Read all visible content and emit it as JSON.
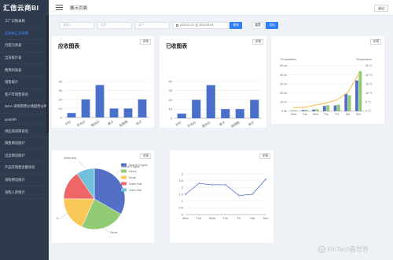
{
  "brand": "汇信云商BI",
  "sidebar": {
    "items": [
      {
        "label": "工厂记账表格",
        "active": false
      },
      {
        "label": "应收帐汇总周期",
        "active": true
      },
      {
        "label": "月度交易表",
        "active": false
      },
      {
        "label": "出货统计表",
        "active": false
      },
      {
        "label": "费用利润表",
        "active": false
      },
      {
        "label": "销售统计",
        "active": false
      },
      {
        "label": "客户年销售排名",
        "active": false
      },
      {
        "label": "WXA-采购销售价格趋势分析",
        "active": false
      },
      {
        "label": "quoteBI",
        "active": false
      },
      {
        "label": "供应商采购排名",
        "active": false
      },
      {
        "label": "销售情况统计",
        "active": false
      },
      {
        "label": "出运情况统计",
        "active": false
      },
      {
        "label": "产品年销售金额排名",
        "active": false
      },
      {
        "label": "采购情况统计",
        "active": false
      },
      {
        "label": "采购入库统计",
        "active": false
      }
    ]
  },
  "header": {
    "title": "展示页面",
    "right_button": "退出"
  },
  "filters": {
    "input1_placeholder": "请输入",
    "input2_placeholder": "品项",
    "input3_placeholder": "客户",
    "date_range": "2024-01-01 至 2024-09-04",
    "search_label": "查询",
    "reset_label": "重置",
    "export_label": "导出"
  },
  "detail_label": "详情",
  "colors": {
    "sidebar_bg": "#2f3a4d",
    "accent": "#2d7ff9",
    "bar_blue": "#4a6fc9",
    "pie_blue": "#5470c6",
    "pie_green": "#91cc75",
    "pie_yellow": "#fac858",
    "pie_red": "#ee6666",
    "pie_cyan": "#73c0de",
    "line_orange": "#f2b233"
  },
  "watermark": "FinTech看世界",
  "chart_data": [
    {
      "type": "bar",
      "title": "应收图表",
      "categories": [
        "衬衫",
        "羊毛衫",
        "雪纺衫",
        "裤子",
        "高跟鞋",
        "袜子"
      ],
      "values": [
        5,
        20,
        36,
        10,
        10,
        20
      ],
      "ylim": [
        0,
        40
      ],
      "yticks": [
        0,
        10,
        20,
        30,
        40
      ],
      "color": "#4a6fc9"
    },
    {
      "type": "bar",
      "title": "已收图表",
      "categories": [
        "衬衫",
        "羊毛衫",
        "雪纺衫",
        "裤子",
        "高跟鞋",
        "袜子"
      ],
      "values": [
        5,
        20,
        36,
        10,
        10,
        20
      ],
      "ylim": [
        0,
        40
      ],
      "yticks": [
        0,
        10,
        20,
        30,
        40
      ],
      "color": "#4a6fc9"
    },
    {
      "type": "bar",
      "title": "",
      "categories": [
        "Mon",
        "Tue",
        "Wed",
        "Thu",
        "Fri",
        "Sat",
        "Sun"
      ],
      "ylabel_left": "Precipitation",
      "ylabel_right": "Temperature",
      "left_ticks": [
        "0 ml",
        "10 ml",
        "20 ml",
        "30 ml",
        "40 ml",
        "50 ml"
      ],
      "right_ticks": [
        "0 °C",
        "5 °C",
        "10 °C",
        "15 °C",
        "20 °C",
        "25 °C"
      ],
      "series": [
        {
          "type": "bar",
          "color": "#5470c6",
          "values": [
            2,
            4.9,
            7,
            23.2,
            25.6,
            76.7,
            135.6
          ]
        },
        {
          "type": "bar",
          "color": "#91cc75",
          "values": [
            2.6,
            5.9,
            9,
            26.4,
            28.7,
            70.7,
            175.6
          ]
        },
        {
          "type": "line",
          "color": "#f2b233",
          "values": [
            2.0,
            2.2,
            3.3,
            4.5,
            6.3,
            10.2,
            20.3
          ]
        }
      ]
    },
    {
      "type": "pie",
      "title": "",
      "legend": [
        "Search Engine",
        "Direct",
        "Email",
        "Union Ads",
        "Video Ads"
      ],
      "slices": [
        {
          "name": "Search Engine",
          "value": 1048,
          "color": "#5470c6"
        },
        {
          "name": "Direct",
          "value": 735,
          "color": "#91cc75"
        },
        {
          "name": "Email",
          "value": 580,
          "color": "#fac858"
        },
        {
          "name": "Union Ads",
          "value": 484,
          "color": "#ee6666"
        },
        {
          "name": "Video Ads",
          "value": 300,
          "color": "#73c0de"
        }
      ],
      "outer_labels": [
        {
          "text": "Video Ads"
        },
        {
          "text": "Search Engine"
        },
        {
          "text": "Direct"
        },
        {
          "text": "E..."
        }
      ]
    },
    {
      "type": "line",
      "title": "",
      "categories": [
        "Mon",
        "Tue",
        "Wed",
        "Thu",
        "Fri",
        "Sat",
        "Sun"
      ],
      "values": [
        1.5,
        2.3,
        2.2,
        2.2,
        1.4,
        1.5,
        2.6
      ],
      "ylim": [
        0,
        3
      ],
      "yticks": [
        "0",
        "0.5",
        "1",
        "1.5",
        "2",
        "2.5",
        "3"
      ],
      "color": "#5470c6"
    }
  ]
}
